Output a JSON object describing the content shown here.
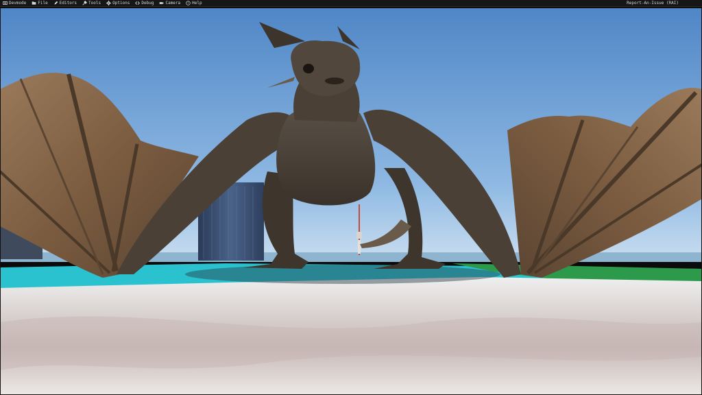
{
  "menubar": {
    "items": [
      {
        "label": "Devmode",
        "icon": "devmode-icon"
      },
      {
        "label": "File",
        "icon": "folder-icon"
      },
      {
        "label": "Editors",
        "icon": "pencil-icon"
      },
      {
        "label": "Tools",
        "icon": "tools-icon"
      },
      {
        "label": "Options",
        "icon": "gear-icon"
      },
      {
        "label": "Debug",
        "icon": "code-icon"
      },
      {
        "label": "Camera",
        "icon": "camera-icon"
      },
      {
        "label": "Help",
        "icon": "help-icon"
      }
    ],
    "report_label": "Report-An-Issue (RAI)"
  },
  "scene": {
    "subject": "dragon",
    "sky_color": "#5f95cf",
    "ground_color": "#dcd6d3",
    "water_color": "#2fd6e6",
    "dragon_color": "#4a4036",
    "wing_color": "#8a6a4c"
  }
}
